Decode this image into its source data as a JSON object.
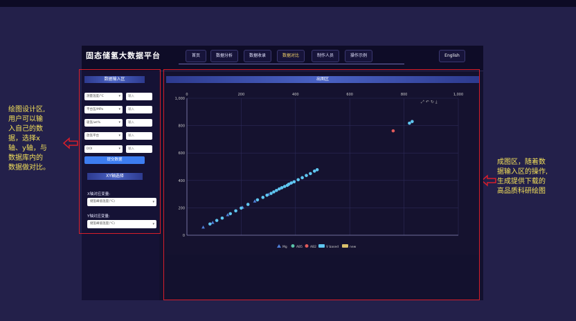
{
  "app": {
    "title": "固态储氢大数据平台",
    "nav": [
      {
        "label": "首页",
        "active": false
      },
      {
        "label": "数据分析",
        "active": false
      },
      {
        "label": "数据收录",
        "active": false
      },
      {
        "label": "数据对比",
        "active": true
      },
      {
        "label": "制作人员",
        "active": false
      },
      {
        "label": "操作示例",
        "active": false
      }
    ],
    "language_label": "English"
  },
  "input_panel": {
    "title": "数据输入区",
    "rows": [
      {
        "select": "测量温度/°C",
        "input_placeholder": "输入"
      },
      {
        "select": "平台压/MPa",
        "input_placeholder": "输入"
      },
      {
        "select": "吸氢/wt%",
        "input_placeholder": "输入"
      },
      {
        "select": "放氢平台",
        "input_placeholder": "输入"
      },
      {
        "select": "DOI",
        "input_placeholder": "输入"
      }
    ],
    "submit_label": "提交数据"
  },
  "axis_panel": {
    "title": "XY轴选择",
    "x_label": "X轴对应变量:",
    "x_value": "储氢峰值温度(°C)",
    "y_label": "Y轴对应变量:",
    "y_value": "储氢峰值温度(°C)"
  },
  "plot_panel": {
    "title": "出图区",
    "toolbox_icons": [
      "zoom-icon",
      "undo-icon",
      "restore-icon",
      "download-icon"
    ]
  },
  "annotations": {
    "left": [
      "绘图设计区,",
      "用户可以输",
      "入自己的数",
      "据，选择x",
      "轴、y轴，与",
      "数据库内的",
      "数据做对比。"
    ],
    "right": [
      "成图区，随着数",
      "据输入区的操作,",
      "生成提供下载的",
      "高品质科研绘图"
    ]
  },
  "colors": {
    "outline": "#d81e2a",
    "annotation_text": "#f3e05a",
    "panel_head": "#4a62c4"
  },
  "chart_data": {
    "type": "scatter",
    "x_ticks": [
      0,
      200,
      400,
      600,
      800,
      "1,000"
    ],
    "y_ticks": [
      0,
      200,
      400,
      600,
      800,
      "1,000"
    ],
    "xlim": [
      0,
      1000
    ],
    "ylim": [
      0,
      1000
    ],
    "grid": true,
    "legend_position": "bottom",
    "series": [
      {
        "name": "Mg",
        "color": "#4f7fd8",
        "marker": "triangle",
        "points": [
          [
            60,
            58
          ],
          [
            95,
            92
          ],
          [
            150,
            148
          ],
          [
            205,
            203
          ],
          [
            250,
            248
          ],
          [
            300,
            298
          ],
          [
            345,
            343
          ],
          [
            380,
            378
          ]
        ]
      },
      {
        "name": "AB5",
        "color": "#5ac3a8",
        "marker": "circle",
        "points": []
      },
      {
        "name": "AB2",
        "color": "#e05a5a",
        "marker": "circle",
        "points": [
          [
            760,
            762
          ]
        ]
      },
      {
        "name": "V based",
        "color": "#5fc6f0",
        "marker": "circle",
        "points": [
          [
            85,
            82
          ],
          [
            110,
            108
          ],
          [
            130,
            125
          ],
          [
            160,
            157
          ],
          [
            180,
            178
          ],
          [
            200,
            198
          ],
          [
            225,
            225
          ],
          [
            260,
            258
          ],
          [
            280,
            276
          ],
          [
            295,
            292
          ],
          [
            310,
            305
          ],
          [
            320,
            316
          ],
          [
            330,
            327
          ],
          [
            340,
            338
          ],
          [
            350,
            347
          ],
          [
            360,
            356
          ],
          [
            370,
            364
          ],
          [
            375,
            372
          ],
          [
            385,
            382
          ],
          [
            395,
            390
          ],
          [
            410,
            405
          ],
          [
            425,
            420
          ],
          [
            440,
            436
          ],
          [
            455,
            450
          ],
          [
            470,
            468
          ],
          [
            480,
            478
          ],
          [
            820,
            818
          ],
          [
            830,
            830
          ]
        ]
      },
      {
        "name": "new",
        "color": "#d9c06b",
        "marker": "circle",
        "points": []
      }
    ]
  }
}
